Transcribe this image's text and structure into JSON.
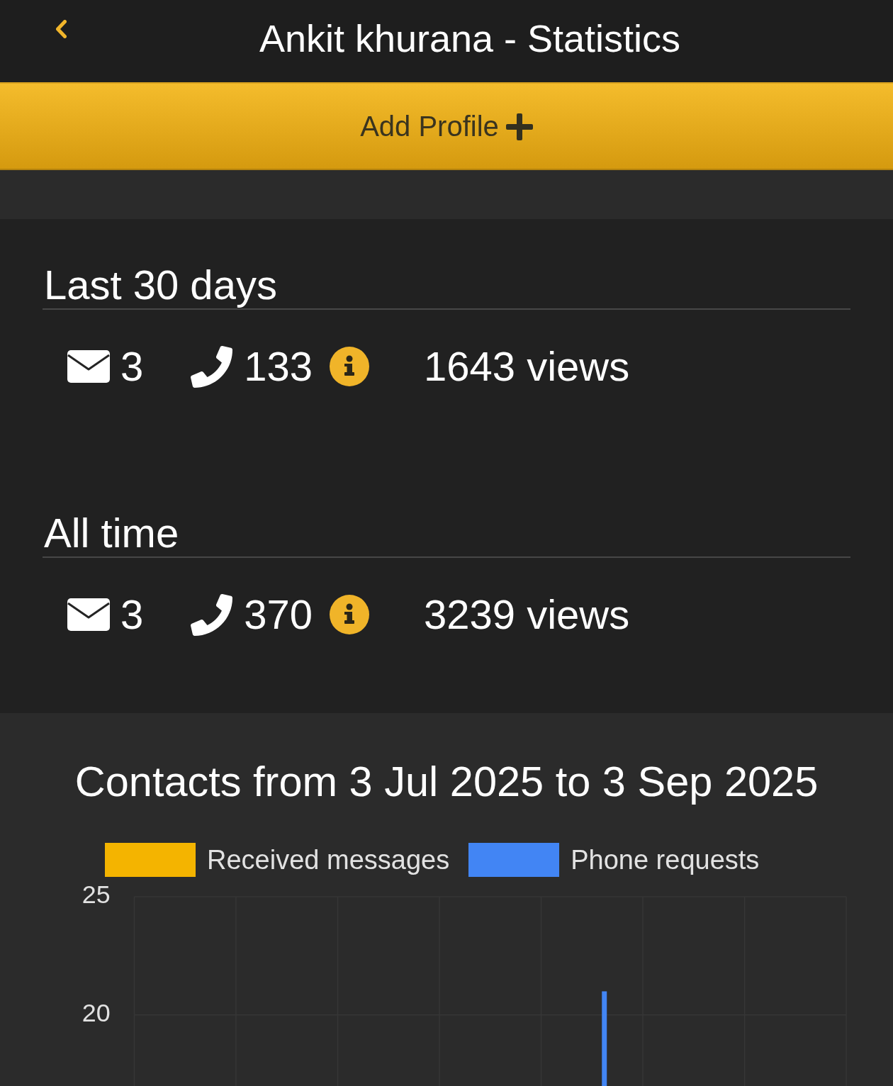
{
  "header": {
    "title": "Ankit khurana - Statistics"
  },
  "add_profile_button": {
    "label": "Add Profile"
  },
  "periods": [
    {
      "title": "Last 30 days",
      "messages": "3",
      "phone_requests": "133",
      "views": "1643 views"
    },
    {
      "title": "All time",
      "messages": "3",
      "phone_requests": "370",
      "views": "3239 views"
    }
  ],
  "contacts_chart": {
    "chart_data": {
      "type": "bar",
      "title": "Contacts from 3 Jul 2025 to 3 Sep 2025",
      "ylim": [
        17,
        25
      ],
      "yticks": [
        25,
        20
      ],
      "series": [
        {
          "name": "Received messages",
          "color": "#f4b400",
          "values": [
            null,
            null,
            null,
            null,
            null,
            null,
            null,
            null,
            null,
            null,
            null,
            null,
            null,
            null,
            null,
            null,
            null,
            null,
            null,
            null,
            null,
            null,
            null,
            null,
            null,
            null,
            null,
            null,
            null,
            null,
            null,
            null,
            null,
            null,
            null,
            null,
            null,
            null,
            null,
            null,
            null,
            null,
            null,
            null,
            null,
            null,
            null,
            null,
            null,
            null,
            null,
            null,
            null,
            null,
            null,
            null,
            null,
            null,
            null,
            null,
            null,
            null,
            null
          ]
        },
        {
          "name": "Phone requests",
          "color": "#4285f4",
          "values": [
            null,
            null,
            null,
            null,
            null,
            null,
            null,
            null,
            null,
            null,
            null,
            null,
            null,
            null,
            null,
            null,
            null,
            null,
            null,
            null,
            null,
            null,
            null,
            null,
            null,
            null,
            null,
            null,
            null,
            null,
            null,
            null,
            null,
            null,
            null,
            null,
            null,
            null,
            null,
            null,
            null,
            21,
            null,
            null,
            null,
            null,
            null,
            null,
            null,
            null,
            null,
            null,
            null,
            null,
            null,
            null,
            null,
            null,
            null,
            null,
            null,
            null,
            null
          ]
        }
      ]
    }
  }
}
